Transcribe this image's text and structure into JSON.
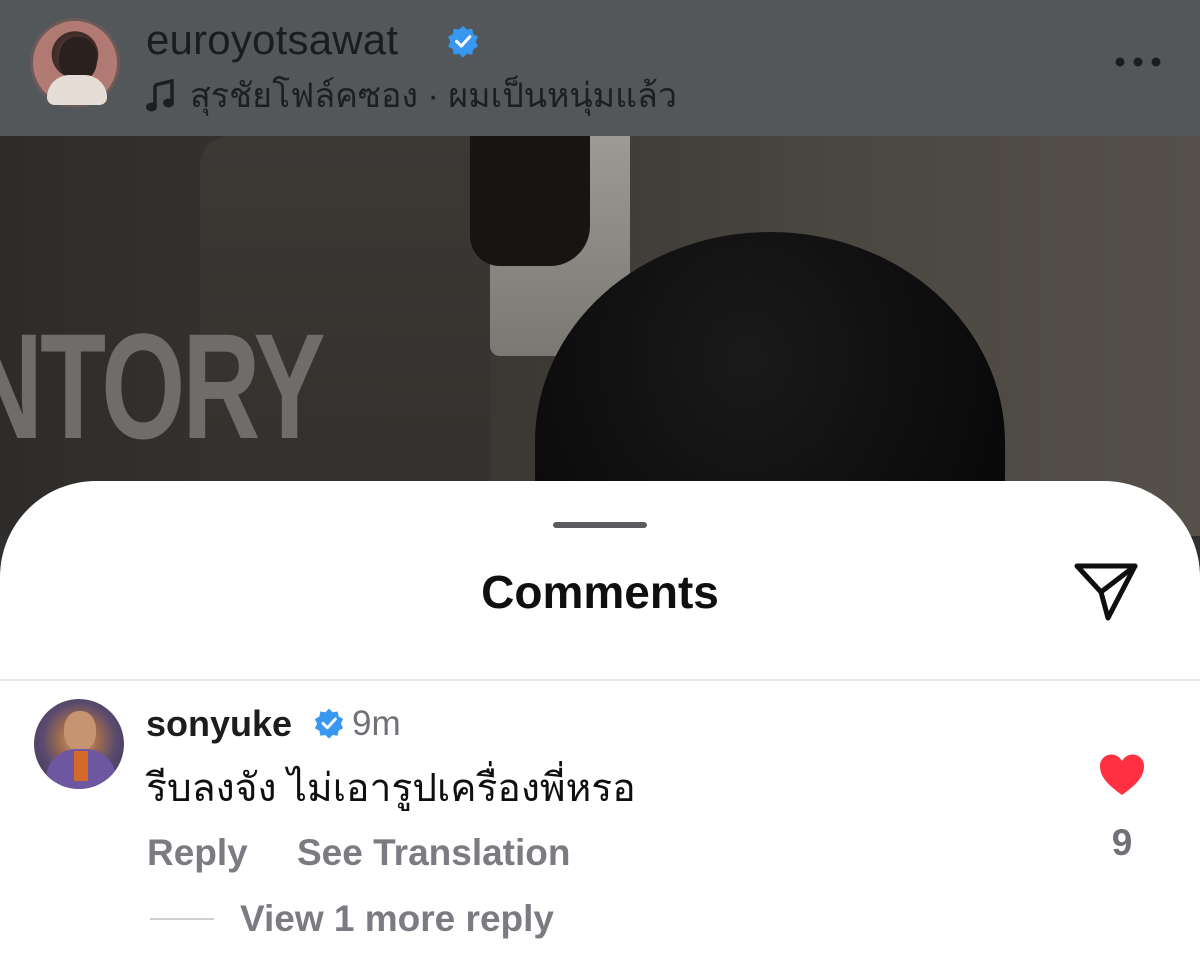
{
  "header": {
    "username": "euroyotsawat",
    "music": "สุรชัยโฟล์คซอง · ผมเป็นหนุ่มแล้ว"
  },
  "photo": {
    "sign_text": "NTORY"
  },
  "sheet": {
    "title": "Comments"
  },
  "comment": {
    "username": "sonyuke",
    "time": "9m",
    "text": "รีบลงจัง ไม่เอารูปเครื่องพี่หรอ",
    "reply_label": "Reply",
    "translate_label": "See Translation",
    "like_count": "9",
    "view_replies_label": "View 1 more reply"
  },
  "colors": {
    "verified": "#3897f0",
    "heart": "#ff3040",
    "header_bg": "#54575a"
  },
  "icons": [
    "verified-badge-icon",
    "music-note-icon",
    "more-options-icon",
    "send-icon",
    "heart-icon"
  ]
}
